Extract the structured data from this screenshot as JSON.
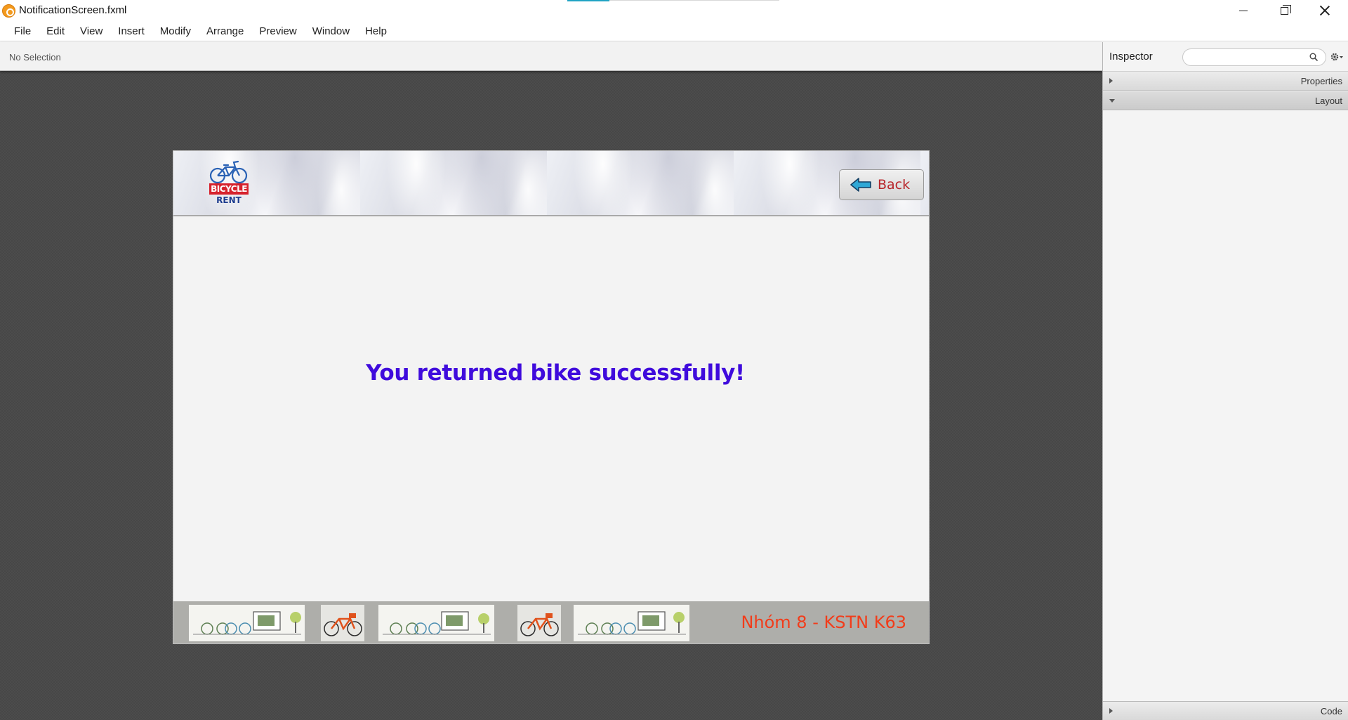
{
  "window": {
    "title": "NotificationScreen.fxml"
  },
  "menu": [
    "File",
    "Edit",
    "View",
    "Insert",
    "Modify",
    "Arrange",
    "Preview",
    "Window",
    "Help"
  ],
  "editor": {
    "selection_text": "No Selection"
  },
  "scene": {
    "logo": {
      "line1": "BICYCLE",
      "line2": "RENT"
    },
    "back_button_label": "Back",
    "message": "You returned bike successfully!",
    "footer_credit": "Nhóm 8 - KSTN K63"
  },
  "inspector": {
    "title": "Inspector",
    "search_value": "",
    "sections": [
      {
        "label": "Properties",
        "expanded": false
      },
      {
        "label": "Layout",
        "expanded": true
      },
      {
        "label": "Code",
        "expanded": false
      }
    ]
  },
  "colors": {
    "message": "#3f0bdc",
    "back_label": "#b8262b",
    "footer_credit": "#f23c1a",
    "logo_red": "#d6222d",
    "logo_blue": "#1e3d8f"
  },
  "icons": [
    "app-icon",
    "minimize-icon",
    "maximize-icon",
    "close-icon",
    "bicycle-icon",
    "back-arrow-icon",
    "search-icon",
    "settings-icon"
  ]
}
